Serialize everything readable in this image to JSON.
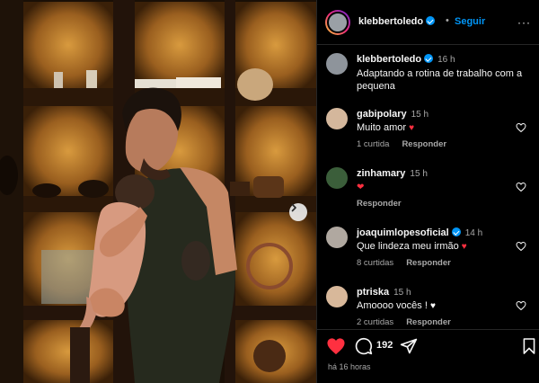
{
  "post": {
    "author": "klebbertoledo",
    "follow_label": "Seguir",
    "more_label": "···",
    "caption_author": "klebbertoledo",
    "caption_time": "16 h",
    "caption_text": "Adaptando a rotina de trabalho com a pequena",
    "posted_ago": "há 16 horas"
  },
  "comments": [
    {
      "user": "gabipolary",
      "verified": false,
      "time": "15 h",
      "text": "Muito amor",
      "emoji": "heart-red",
      "likes": "1 curtida",
      "reply": "Responder"
    },
    {
      "user": "zinhamary",
      "verified": false,
      "time": "15 h",
      "text": "",
      "emoji": "heart-eyes",
      "likes": "",
      "reply": "Responder"
    },
    {
      "user": "joaquimlopesoficial",
      "verified": true,
      "time": "14 h",
      "text": "Que lindeza meu irmão",
      "emoji": "heart-red",
      "likes": "8 curtidas",
      "reply": "Responder"
    },
    {
      "user": "ptriska",
      "verified": false,
      "time": "15 h",
      "text": "Amoooo vocês !",
      "emoji": "heart-white",
      "likes": "2 curtidas",
      "reply": "Responder"
    }
  ],
  "actions": {
    "comment_count": "192"
  },
  "icons": {
    "like": "heart-filled-icon",
    "comment": "comment-icon",
    "share": "send-icon",
    "save": "bookmark-icon",
    "next": "chevron-right-icon"
  },
  "colors": {
    "like_red": "#ff3040",
    "verified_blue": "#0095f6",
    "follow_blue": "#0095f6"
  }
}
